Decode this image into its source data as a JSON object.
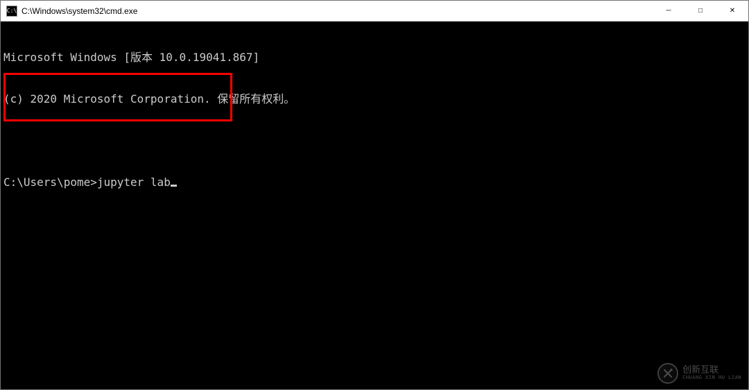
{
  "titlebar": {
    "icon_label": "C:\\",
    "title": "C:\\Windows\\system32\\cmd.exe"
  },
  "window_controls": {
    "minimize": "─",
    "maximize": "□",
    "close": "✕"
  },
  "terminal": {
    "line1": "Microsoft Windows [版本 10.0.19041.867]",
    "line2": "(c) 2020 Microsoft Corporation. 保留所有权利。",
    "prompt": "C:\\Users\\pome>",
    "command": "jupyter lab"
  },
  "watermark": {
    "cn": "创新互联",
    "en": "CHUANG XIN HU LIAN"
  }
}
